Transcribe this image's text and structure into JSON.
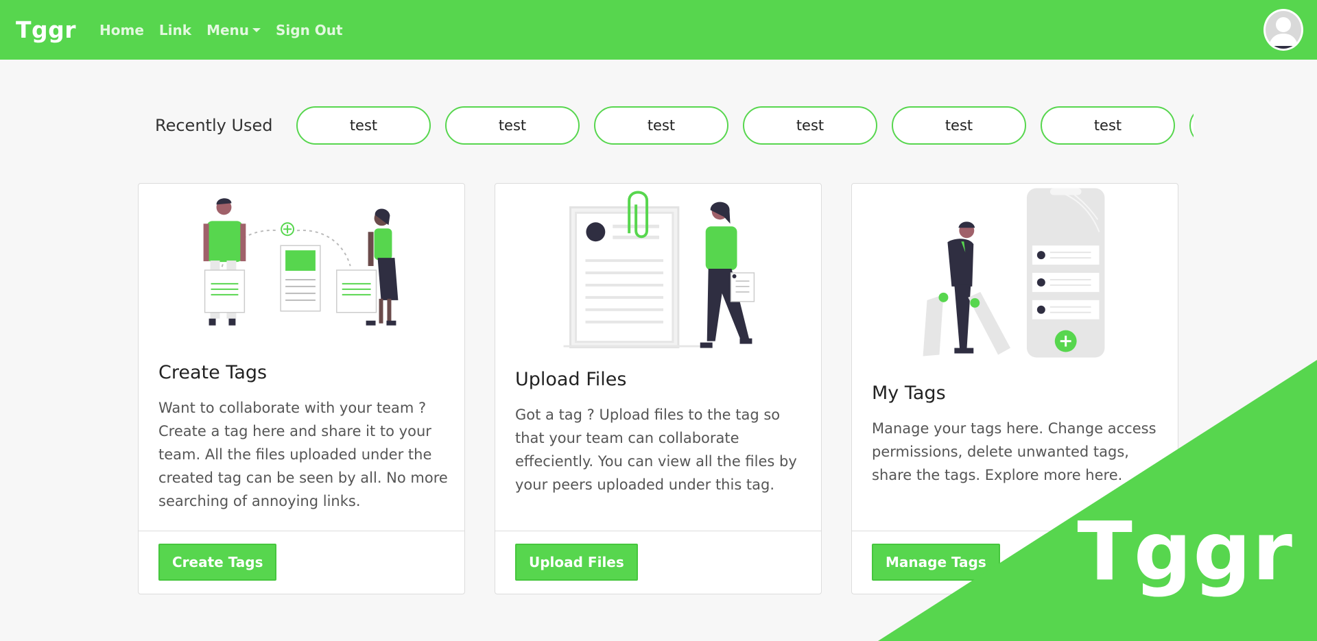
{
  "nav": {
    "brand": "Tggr",
    "links": [
      "Home",
      "Link",
      "Menu",
      "Sign Out"
    ]
  },
  "recent": {
    "label": "Recently Used",
    "chips": [
      "test",
      "test",
      "test",
      "test",
      "test",
      "test"
    ]
  },
  "cards": [
    {
      "title": "Create Tags",
      "text": "Want to collaborate with your team ? Create a tag here and share it to your team. All the files uploaded under the created tag can be seen by all. No more searching of annoying links.",
      "button": "Create Tags"
    },
    {
      "title": "Upload Files",
      "text": "Got a tag ? Upload files to the tag so that your team can collaborate effeciently. You can view all the files by your peers uploaded under this tag.",
      "button": "Upload Files"
    },
    {
      "title": "My Tags",
      "text": "Manage your tags here. Change access permissions, delete unwanted tags, share the tags. Explore more here.",
      "button": "Manage Tags"
    }
  ],
  "corner_logo": "Tggr",
  "colors": {
    "brand": "#57d64e",
    "dark": "#2f2e41",
    "light_gray": "#e6e6e6"
  }
}
